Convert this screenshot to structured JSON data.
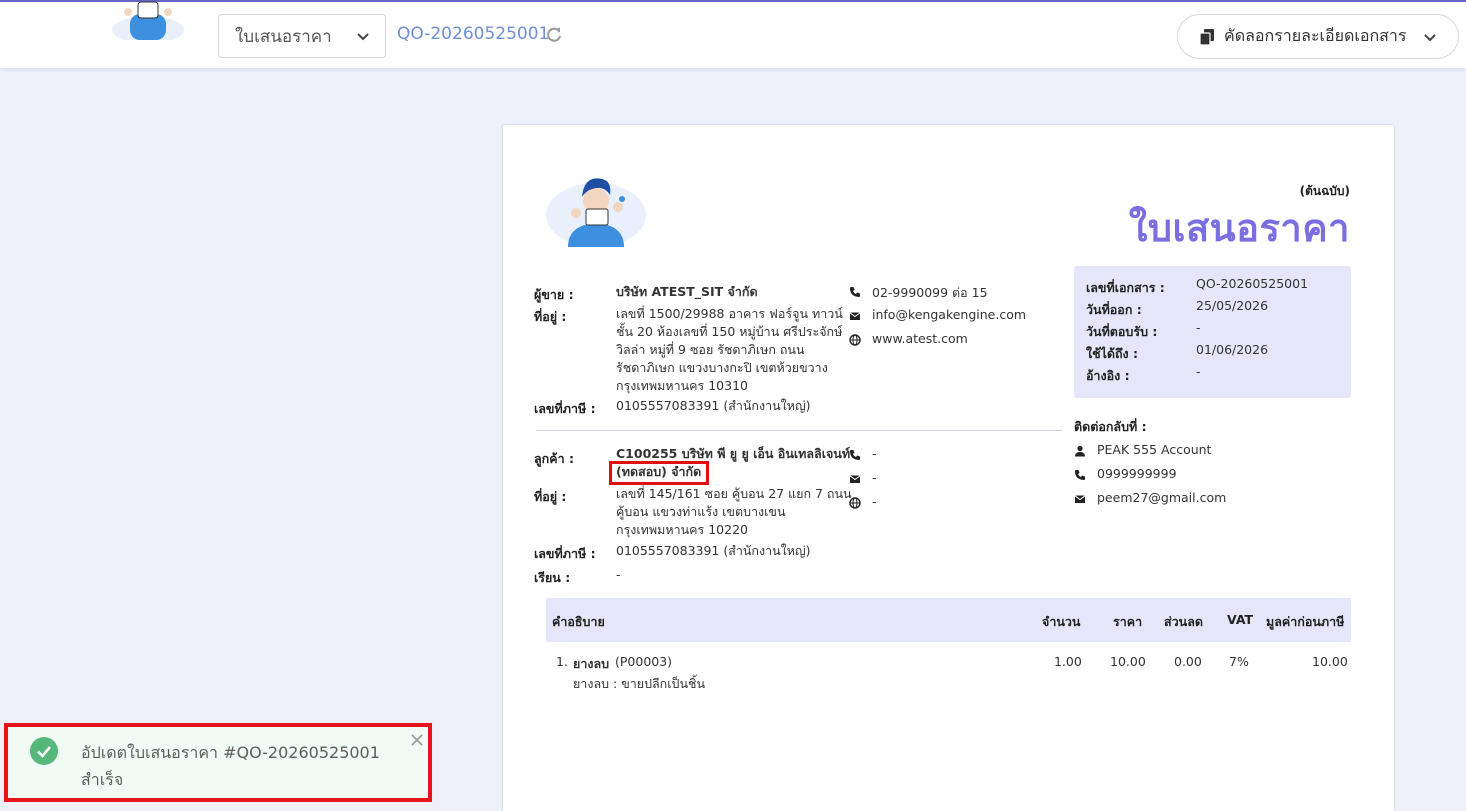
{
  "topbar": {
    "doc_type": "ใบเสนอราคา",
    "doc_number": "QO-20260525001",
    "copy_button": "คัดลอกรายละเอียดเอกสาร"
  },
  "document": {
    "copy_label": "(ต้นฉบับ)",
    "title": "ใบเสนอราคา",
    "seller": {
      "label": "ผู้ขาย :",
      "name": "บริษัท ATEST_SIT จำกัด",
      "address_label": "ที่อยู่ :",
      "address_lines": [
        "เลขที่ 1500/29988 อาคาร ฟอร์จูน ทาวน์",
        "ชั้น 20 ห้องเลขที่ 150 หมู่บ้าน ศรีประจักษ์",
        "วิลล่า หมู่ที่ 9 ซอย รัชดาภิเษก ถนน",
        "รัชดาภิเษก แขวงบางกะปิ เขตห้วยขวาง",
        "กรุงเทพมหานคร 10310"
      ],
      "tax_label": "เลขที่ภาษี :",
      "tax_id": "0105557083391 (สำนักงานใหญ่)",
      "phone": "02-9990099 ต่อ 15",
      "email": "info@kengakengine.com",
      "website": "www.atest.com"
    },
    "customer": {
      "label": "ลูกค้า :",
      "name_line1": "C100255 บริษัท พี ยู ยู เอ็น อินเทลลิเจนท์",
      "name_line2": "(ทดสอบ) จำกัด",
      "address_label": "ที่อยู่ :",
      "address_lines": [
        "เลขที่ 145/161 ซอย คู้บอน 27 แยก 7 ถนน",
        "คู้บอน  แขวงท่าแร้ง เขตบางเขน",
        "กรุงเทพมหานคร 10220"
      ],
      "tax_label": "เลขที่ภาษี :",
      "tax_id": "0105557083391 (สำนักงานใหญ่)",
      "attn_label": "เรียน :",
      "attn": "-",
      "phone": "-",
      "email": "-",
      "website": "-"
    },
    "info": {
      "doc_no_label": "เลขที่เอกสาร :",
      "doc_no": "QO-20260525001",
      "issue_label": "วันที่ออก :",
      "issue_date": "25/05/2026",
      "reply_label": "วันที่ตอบรับ :",
      "reply_date": "-",
      "valid_label": "ใช้ได้ถึง :",
      "valid_date": "01/06/2026",
      "ref_label": "อ้างอิง :",
      "ref": "-"
    },
    "contact": {
      "label": "ติดต่อกลับที่ :",
      "name": "PEAK 555 Account",
      "phone": "0999999999",
      "email": "peem27@gmail.com"
    },
    "table": {
      "headers": {
        "description": "คำอธิบาย",
        "qty": "จำนวน",
        "price": "ราคา",
        "discount": "ส่วนลด",
        "vat": "VAT",
        "amount": "มูลค่าก่อนภาษี"
      },
      "rows": [
        {
          "no": "1.",
          "name": "ยางลบ",
          "code": "(P00003)",
          "detail": "ยางลบ : ขายปลีกเป็นชิ้น",
          "qty": "1.00",
          "price": "10.00",
          "discount": "0.00",
          "vat": "7%",
          "amount": "10.00"
        }
      ]
    }
  },
  "toast": {
    "message_line1": "อัปเดตใบเสนอราคา #QO-20260525001",
    "message_line2": "สำเร็จ"
  },
  "colors": {
    "accent": "#7a6ee0",
    "link": "#6f8fd6",
    "success": "#55b87a",
    "highlight": "#e01010"
  }
}
